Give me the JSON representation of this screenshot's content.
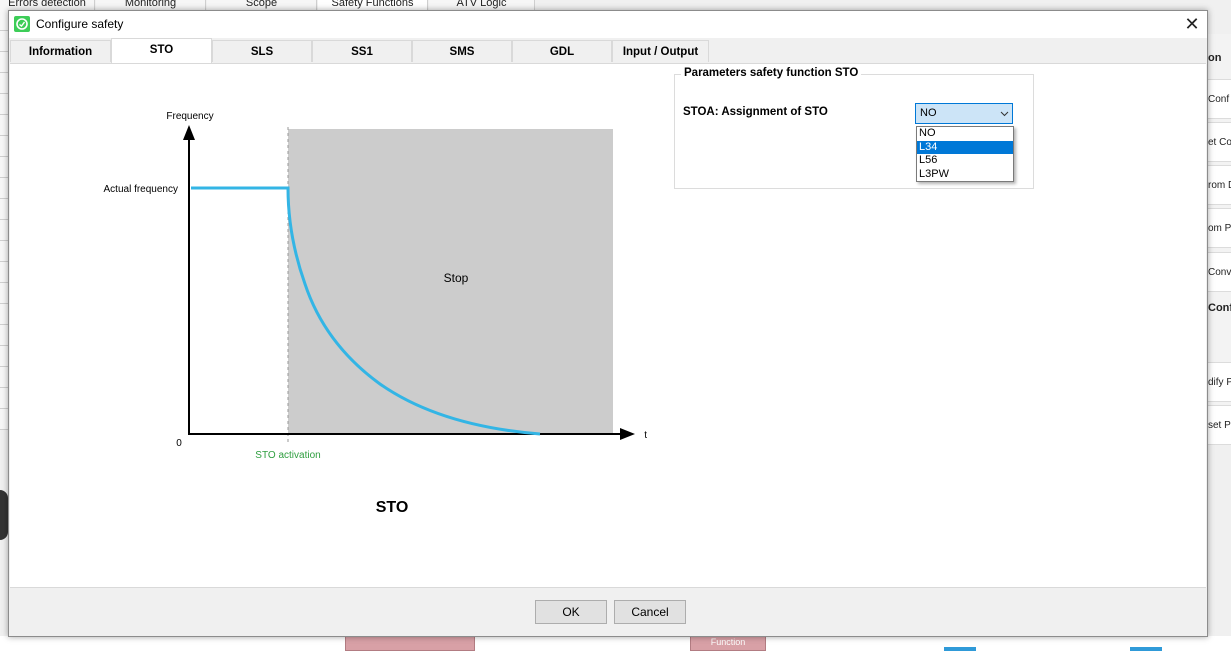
{
  "background": {
    "tabs": [
      "Errors detection",
      "Monitoring",
      "Scope",
      "Safety Functions",
      "ATV Logic"
    ],
    "right_panel": {
      "heading": "on",
      "items": [
        "Conf",
        "et Co",
        "rom D",
        "om P",
        "Conv"
      ],
      "heading2": "Conf",
      "items2": [
        "dify P",
        "set P"
      ]
    },
    "bottom_text": "Function"
  },
  "dialog": {
    "title": "Configure safety",
    "close_glyph": "✕",
    "tabs": [
      "Information",
      "STO",
      "SLS",
      "SS1",
      "SMS",
      "GDL",
      "Input / Output"
    ],
    "active_tab": "STO",
    "diagram": {
      "y_axis_label": "Frequency",
      "x_axis_label": "t",
      "actual_frequency_label": "Actual frequency",
      "zero_label": "0",
      "activation_label": "STO activation",
      "region_label": "Stop",
      "caption": "STO",
      "curve_color": "#33b5e5",
      "activation_color": "#2e9e3f",
      "region_color": "#cccccc"
    },
    "group_title": "Parameters safety function STO",
    "param_label": "STOA: Assignment of STO",
    "select": {
      "value": "NO",
      "options": [
        "NO",
        "L34",
        "L56",
        "L3PW"
      ],
      "highlighted": "L34"
    },
    "buttons": {
      "ok": "OK",
      "cancel": "Cancel"
    }
  }
}
